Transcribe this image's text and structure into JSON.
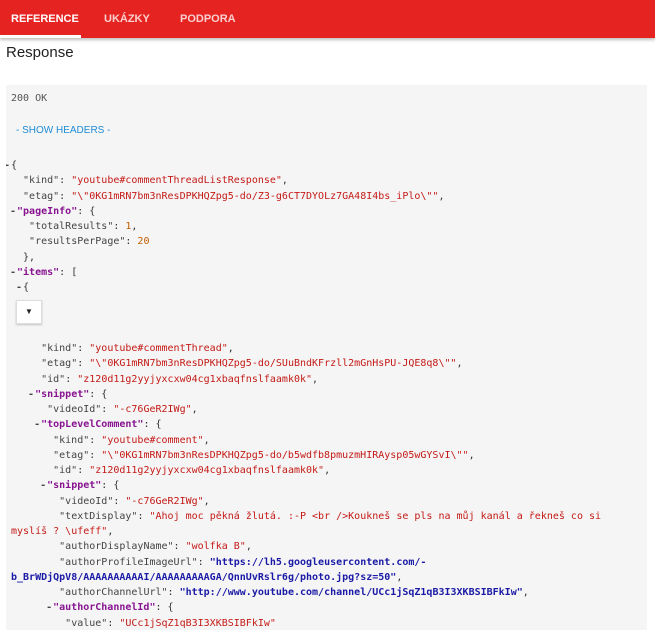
{
  "nav": {
    "tabs": [
      {
        "label": "REFERENCE",
        "active": true
      },
      {
        "label": "UKÁZKY",
        "active": false
      },
      {
        "label": "PODPORA",
        "active": false
      }
    ]
  },
  "colors": {
    "accent": "#e52421",
    "link": "#1f8dd6",
    "string": "#c41a16",
    "number": "#c25d00",
    "object_key": "#881391"
  },
  "page": {
    "title": "Response"
  },
  "response": {
    "status": "200 OK",
    "show_headers": "- SHOW HEADERS -",
    "dropdown_icon": "caret-down-icon",
    "lines": [
      {
        "indent": 0,
        "toggle": "-",
        "tokens": [
          {
            "t": "p",
            "v": "{"
          }
        ]
      },
      {
        "indent": 2,
        "tokens": [
          {
            "t": "k",
            "v": "\"kind\""
          },
          {
            "t": "p",
            "v": ": "
          },
          {
            "t": "s",
            "v": "\"youtube#commentThreadListResponse\""
          },
          {
            "t": "p",
            "v": ","
          }
        ]
      },
      {
        "indent": 2,
        "tokens": [
          {
            "t": "k",
            "v": "\"etag\""
          },
          {
            "t": "p",
            "v": ": "
          },
          {
            "t": "s",
            "v": "\"\\\"0KG1mRN7bm3nResDPKHQZpg5-do/Z3-g6CT7DYOLz7GA48I4bs_iPlo\\\"\""
          },
          {
            "t": "p",
            "v": ","
          }
        ]
      },
      {
        "indent": 1,
        "toggle": "-",
        "tokens": [
          {
            "t": "ko",
            "v": "\"pageInfo\""
          },
          {
            "t": "p",
            "v": ": {"
          }
        ]
      },
      {
        "indent": 3,
        "tokens": [
          {
            "t": "k",
            "v": "\"totalResults\""
          },
          {
            "t": "p",
            "v": ": "
          },
          {
            "t": "n",
            "v": "1"
          },
          {
            "t": "p",
            "v": ","
          }
        ]
      },
      {
        "indent": 3,
        "tokens": [
          {
            "t": "k",
            "v": "\"resultsPerPage\""
          },
          {
            "t": "p",
            "v": ": "
          },
          {
            "t": "n",
            "v": "20"
          }
        ]
      },
      {
        "indent": 2,
        "tokens": [
          {
            "t": "p",
            "v": "},"
          }
        ]
      },
      {
        "indent": 1,
        "toggle": "-",
        "tokens": [
          {
            "t": "ko",
            "v": "\"items\""
          },
          {
            "t": "p",
            "v": ": ["
          }
        ]
      },
      {
        "indent": 2,
        "toggle": "-",
        "tokens": [
          {
            "t": "p",
            "v": "{"
          }
        ]
      },
      {
        "indent": 0,
        "tokens": []
      },
      {
        "indent": 0,
        "tokens": []
      },
      {
        "indent": 0,
        "tokens": []
      },
      {
        "indent": 5,
        "tokens": [
          {
            "t": "k",
            "v": "\"kind\""
          },
          {
            "t": "p",
            "v": ": "
          },
          {
            "t": "s",
            "v": "\"youtube#commentThread\""
          },
          {
            "t": "p",
            "v": ","
          }
        ]
      },
      {
        "indent": 5,
        "tokens": [
          {
            "t": "k",
            "v": "\"etag\""
          },
          {
            "t": "p",
            "v": ": "
          },
          {
            "t": "s",
            "v": "\"\\\"0KG1mRN7bm3nResDPKHQZpg5-do/SUuBndKFrzll2mGnHsPU-JQE8q8\\\"\""
          },
          {
            "t": "p",
            "v": ","
          }
        ]
      },
      {
        "indent": 5,
        "tokens": [
          {
            "t": "k",
            "v": "\"id\""
          },
          {
            "t": "p",
            "v": ": "
          },
          {
            "t": "s",
            "v": "\"z120d11g2yyjyxcxw04cg1xbaqfnslfaamk0k\""
          },
          {
            "t": "p",
            "v": ","
          }
        ]
      },
      {
        "indent": 4,
        "toggle": "-",
        "tokens": [
          {
            "t": "ko",
            "v": "\"snippet\""
          },
          {
            "t": "p",
            "v": ": {"
          }
        ]
      },
      {
        "indent": 6,
        "tokens": [
          {
            "t": "k",
            "v": "\"videoId\""
          },
          {
            "t": "p",
            "v": ": "
          },
          {
            "t": "s",
            "v": "\"-c76GeR2IWg\""
          },
          {
            "t": "p",
            "v": ","
          }
        ]
      },
      {
        "indent": 5,
        "toggle": "-",
        "tokens": [
          {
            "t": "ko",
            "v": "\"topLevelComment\""
          },
          {
            "t": "p",
            "v": ": {"
          }
        ]
      },
      {
        "indent": 7,
        "tokens": [
          {
            "t": "k",
            "v": "\"kind\""
          },
          {
            "t": "p",
            "v": ": "
          },
          {
            "t": "s",
            "v": "\"youtube#comment\""
          },
          {
            "t": "p",
            "v": ","
          }
        ]
      },
      {
        "indent": 7,
        "tokens": [
          {
            "t": "k",
            "v": "\"etag\""
          },
          {
            "t": "p",
            "v": ": "
          },
          {
            "t": "s",
            "v": "\"\\\"0KG1mRN7bm3nResDPKHQZpg5-do/b5wdfb8pmuzmHIRAysp05wGYSvI\\\"\""
          },
          {
            "t": "p",
            "v": ","
          }
        ]
      },
      {
        "indent": 7,
        "tokens": [
          {
            "t": "k",
            "v": "\"id\""
          },
          {
            "t": "p",
            "v": ": "
          },
          {
            "t": "s",
            "v": "\"z120d11g2yyjyxcxw04cg1xbaqfnslfaamk0k\""
          },
          {
            "t": "p",
            "v": ","
          }
        ]
      },
      {
        "indent": 6,
        "toggle": "-",
        "tokens": [
          {
            "t": "ko",
            "v": "\"snippet\""
          },
          {
            "t": "p",
            "v": ": {"
          }
        ]
      },
      {
        "indent": 8,
        "tokens": [
          {
            "t": "k",
            "v": "\"videoId\""
          },
          {
            "t": "p",
            "v": ": "
          },
          {
            "t": "s",
            "v": "\"-c76GeR2IWg\""
          },
          {
            "t": "p",
            "v": ","
          }
        ]
      },
      {
        "indent": 8,
        "tokens": [
          {
            "t": "k",
            "v": "\"textDisplay\""
          },
          {
            "t": "p",
            "v": ": "
          },
          {
            "t": "s",
            "v": "\"Ahoj moc pěkná žlutá. :-P <br />Koukneš se pls na můj kanál a řekneš co si"
          }
        ]
      },
      {
        "indent": 0,
        "tokens": [
          {
            "t": "s",
            "v": "myslíš ? \\ufeff\""
          },
          {
            "t": "p",
            "v": ","
          }
        ]
      },
      {
        "indent": 8,
        "tokens": [
          {
            "t": "k",
            "v": "\"authorDisplayName\""
          },
          {
            "t": "p",
            "v": ": "
          },
          {
            "t": "s",
            "v": "\"wolfka B\""
          },
          {
            "t": "p",
            "v": ","
          }
        ]
      },
      {
        "indent": 8,
        "tokens": [
          {
            "t": "k",
            "v": "\"authorProfileImageUrl\""
          },
          {
            "t": "p",
            "v": ": "
          },
          {
            "t": "u",
            "v": "\"https://lh5.googleusercontent.com/-"
          }
        ]
      },
      {
        "indent": 0,
        "tokens": [
          {
            "t": "u",
            "v": "b_BrWDjQpV8/AAAAAAAAAAI/AAAAAAAAAGA/QnnUvRslr6g/photo.jpg?sz=50\""
          },
          {
            "t": "p",
            "v": ","
          }
        ]
      },
      {
        "indent": 8,
        "tokens": [
          {
            "t": "k",
            "v": "\"authorChannelUrl\""
          },
          {
            "t": "p",
            "v": ": "
          },
          {
            "t": "u",
            "v": "\"http://www.youtube.com/channel/UCc1jSqZ1qB3I3XKBSIBFkIw\""
          },
          {
            "t": "p",
            "v": ","
          }
        ]
      },
      {
        "indent": 7,
        "toggle": "-",
        "tokens": [
          {
            "t": "ko",
            "v": "\"authorChannelId\""
          },
          {
            "t": "p",
            "v": ": {"
          }
        ]
      },
      {
        "indent": 9,
        "tokens": [
          {
            "t": "k",
            "v": "\"value\""
          },
          {
            "t": "p",
            "v": ": "
          },
          {
            "t": "s",
            "v": "\"UCc1jSqZ1qB3I3XKBSIBFkIw\""
          }
        ]
      },
      {
        "indent": 8,
        "tokens": [
          {
            "t": "p",
            "v": "},"
          }
        ]
      }
    ]
  }
}
